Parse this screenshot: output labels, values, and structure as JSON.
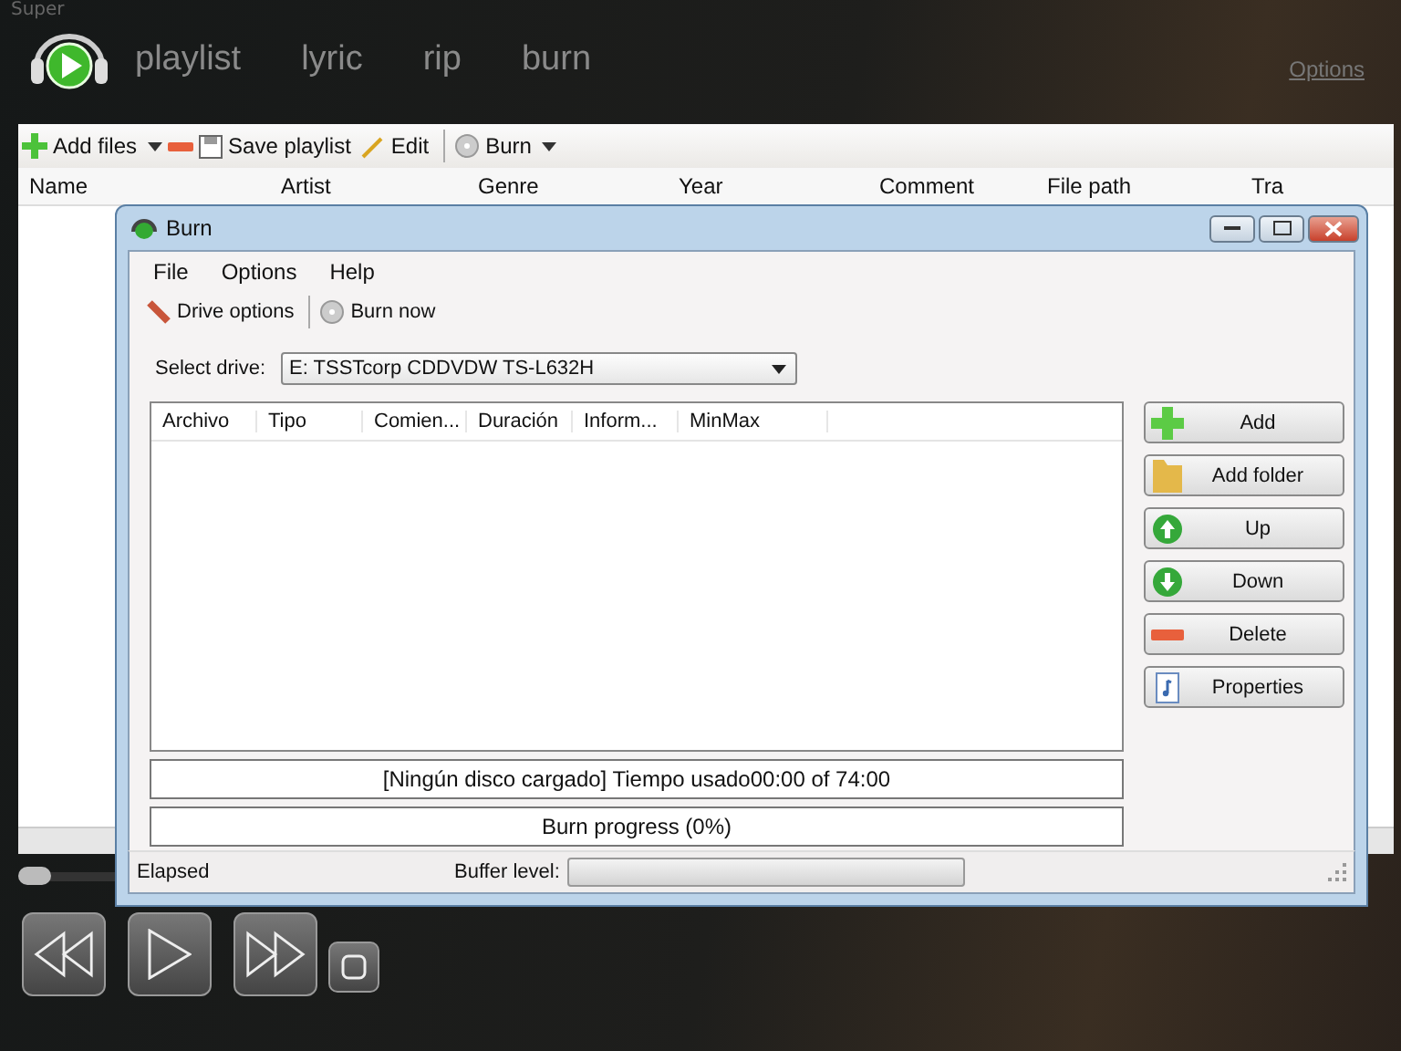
{
  "app_title": "Super",
  "nav_tabs": [
    {
      "label": "playlist",
      "selected": false
    },
    {
      "label": "lyric",
      "selected": false
    },
    {
      "label": "rip",
      "selected": false
    },
    {
      "label": "burn",
      "selected": false
    }
  ],
  "options_link": "Options",
  "toolbar": {
    "add_files": "Add files",
    "save_playlist": "Save playlist",
    "edit": "Edit",
    "burn": "Burn"
  },
  "playlist_columns": [
    "Name",
    "Artist",
    "Genre",
    "Year",
    "Comment",
    "File path",
    "Tra"
  ],
  "seek_slider": {
    "level": 0
  },
  "burn_dialog": {
    "title": "Burn",
    "menu": [
      "File",
      "Options",
      "Help"
    ],
    "toolbar": {
      "drive_options": "Drive options",
      "burn_now": "Burn now"
    },
    "select_drive": {
      "label": "Select drive:",
      "value": "E:  TSSTcorp CDDVDW TS-L632H"
    },
    "columns": [
      "Archivo",
      "Tipo",
      "Comien...",
      "Duración",
      "Inform...",
      "MinMax"
    ],
    "side_buttons": [
      {
        "kind": "add",
        "label": "Add"
      },
      {
        "kind": "folder",
        "label": "Add folder"
      },
      {
        "kind": "up",
        "label": "Up"
      },
      {
        "kind": "down",
        "label": "Down"
      },
      {
        "kind": "delete",
        "label": "Delete"
      },
      {
        "kind": "properties",
        "label": "Properties"
      }
    ],
    "disc_status": "[Ningún disco cargado] Tiempo usado00:00 of 74:00",
    "burn_progress": "Burn progress (0%)",
    "status_bar": {
      "elapsed": "Elapsed",
      "buffer_label": "Buffer level:",
      "buffer": {
        "level": 0
      }
    }
  }
}
